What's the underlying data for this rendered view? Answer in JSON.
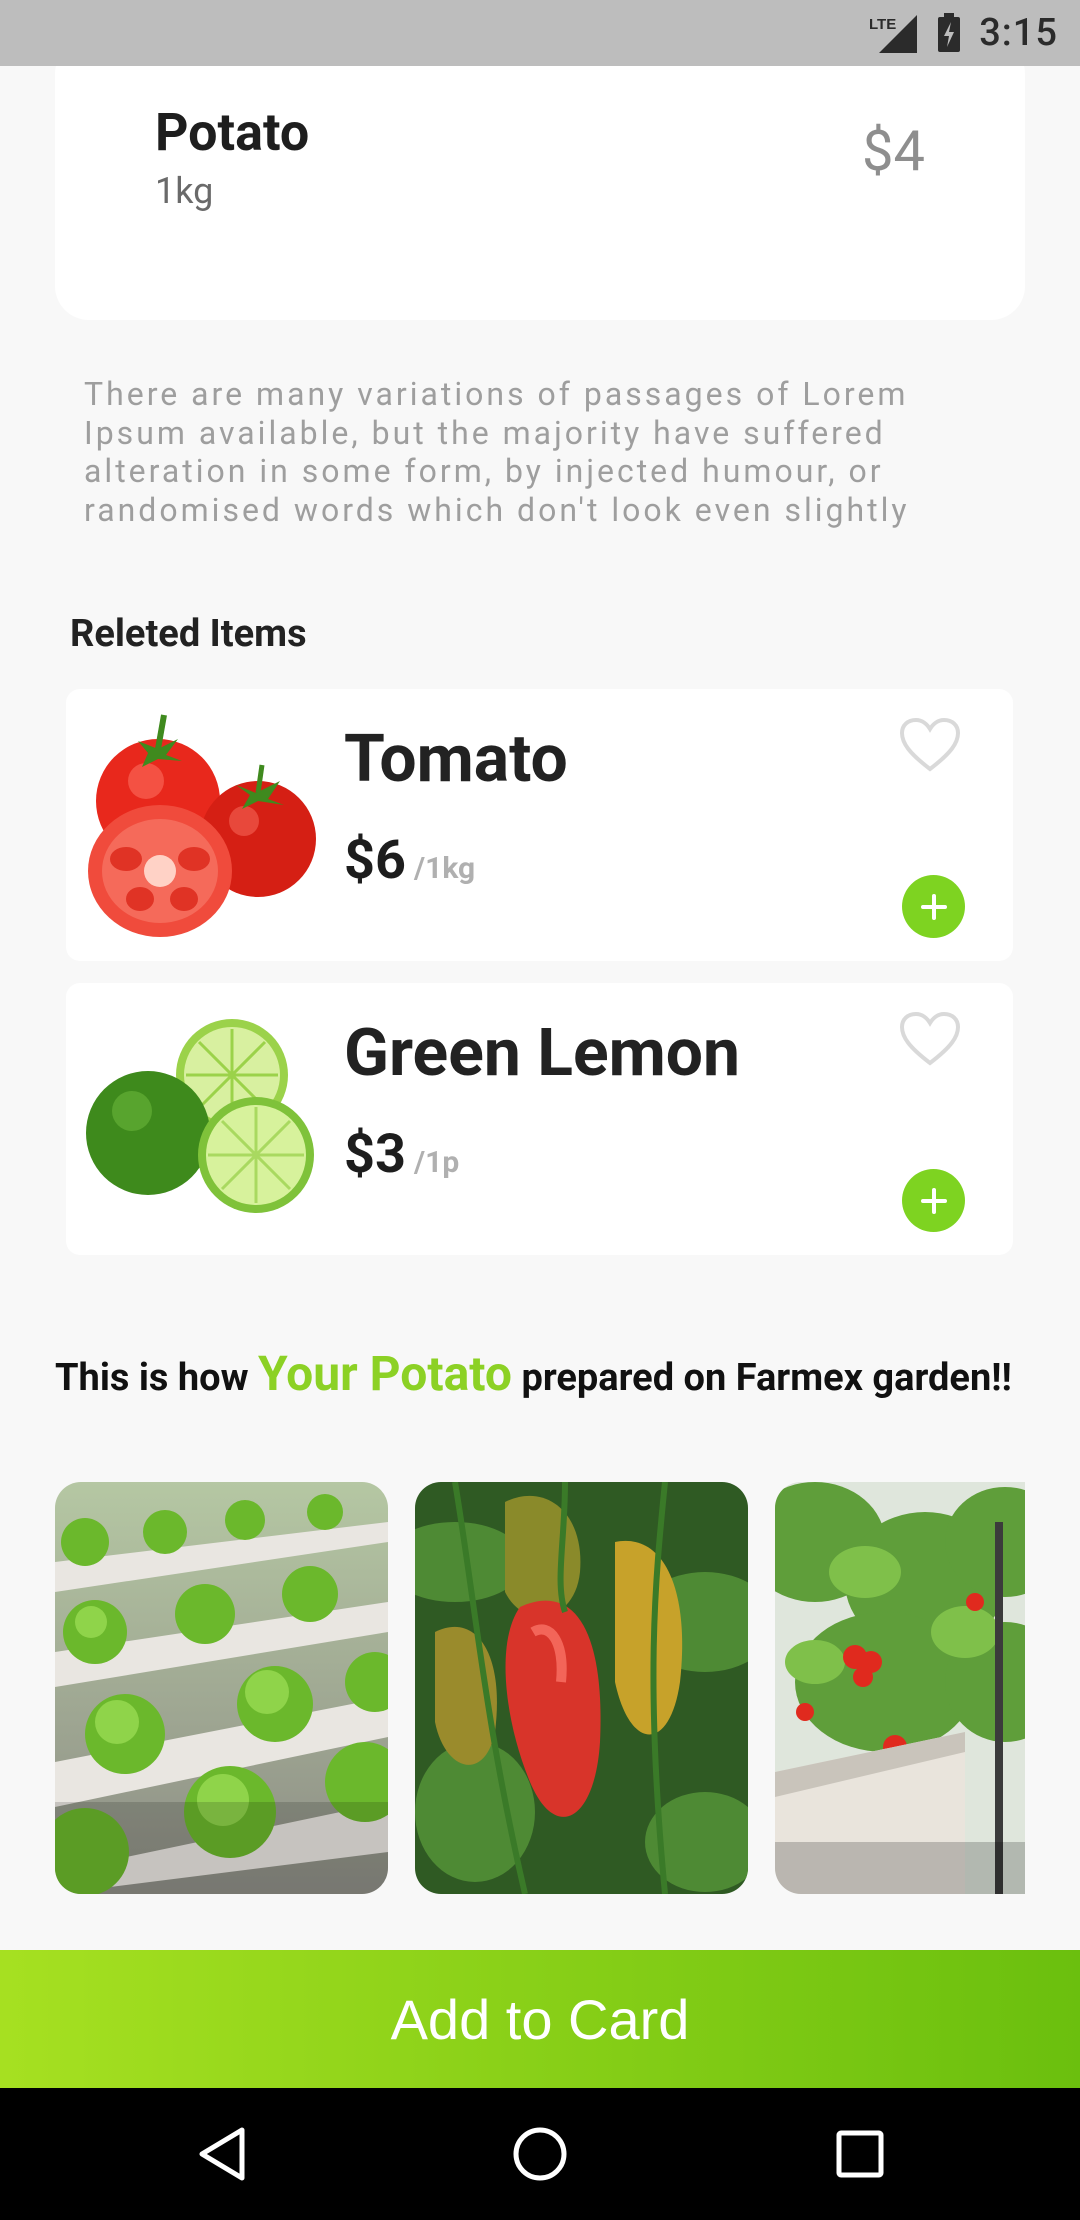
{
  "status_bar": {
    "network": "LTE",
    "time": "3:15",
    "icons": [
      "lte-signal-icon",
      "battery-charging-icon"
    ]
  },
  "product": {
    "name": "Potato",
    "weight": "1kg",
    "price": "$4",
    "description": "There are many variations of passages of Lorem Ipsum available, but the majority have suffered alteration in some form, by injected humour, or randomised words which don't look even slightly"
  },
  "related": {
    "title": "Releted Items",
    "items": [
      {
        "name": "Tomato",
        "price": "$6",
        "unit": "/1kg",
        "image": "tomato-image"
      },
      {
        "name": "Green Lemon",
        "price": "$3",
        "unit": "/1p",
        "image": "green-lemon-image"
      }
    ]
  },
  "garden": {
    "prefix": "This is how ",
    "highlight": "Your Potato",
    "suffix": " prepared on Farmex garden!!",
    "photos": [
      "lettuce-hydroponics-photo",
      "peppers-photo",
      "tomato-plants-photo"
    ]
  },
  "cta": {
    "label": "Add to Card"
  },
  "nav": {
    "icons": [
      "back-icon",
      "home-icon",
      "recents-icon"
    ]
  },
  "colors": {
    "accent": "#7ed321",
    "accent_text": "#8cd125",
    "cta_start": "#a6e021",
    "cta_end": "#6bbf0e",
    "status_bar": "#bdbdbd"
  }
}
